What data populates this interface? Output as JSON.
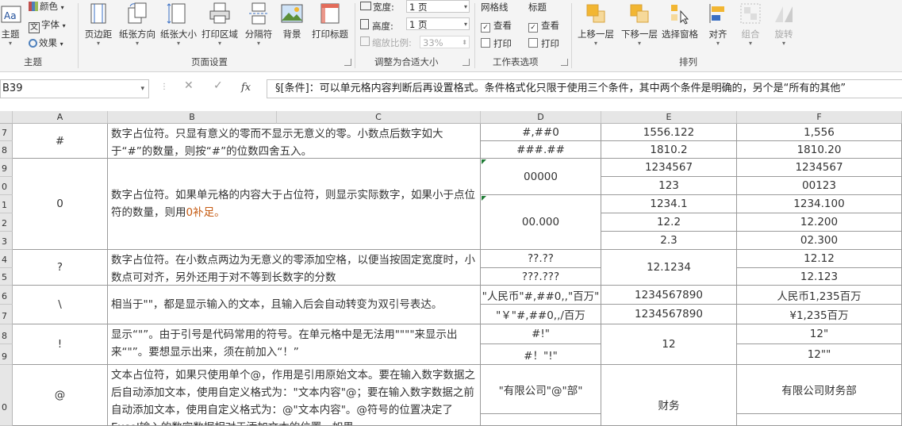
{
  "ribbon": {
    "theme_group": {
      "colors": "颜色",
      "fonts": "字体",
      "effects": "效果",
      "themes": "主题",
      "label": "主题"
    },
    "page_setup": {
      "margins": "页边距",
      "orientation": "纸张方向",
      "size": "纸张大小",
      "print_area": "打印区域",
      "breaks": "分隔符",
      "background": "背景",
      "print_titles": "打印标题",
      "label": "页面设置"
    },
    "scale_to_fit": {
      "width_label": "宽度:",
      "width_value": "1 页",
      "height_label": "高度:",
      "height_value": "1 页",
      "scale_label": "缩放比例:",
      "scale_value": "33%",
      "label": "调整为合适大小"
    },
    "sheet_options": {
      "gridlines": "网格线",
      "headings": "标题",
      "view": "查看",
      "print": "打印",
      "label": "工作表选项"
    },
    "arrange": {
      "bring_forward": "上移一层",
      "send_backward": "下移一层",
      "selection_pane": "选择窗格",
      "align": "对齐",
      "group": "组合",
      "rotate": "旋转",
      "label": "排列"
    }
  },
  "formula_bar": {
    "name_box": "B39",
    "fx": "fx",
    "content": "§[条件]：可以单元格内容判断后再设置格式。条件格式化只限于使用三个条件，其中两个条件是明确的，另个是“所有的其他”"
  },
  "columns": [
    "A",
    "B",
    "C",
    "D",
    "E",
    "F"
  ],
  "rows": [
    "7",
    "8",
    "9",
    "0",
    "1",
    "2",
    "3",
    "4",
    "5",
    "6",
    "7",
    "8",
    "9",
    "0"
  ],
  "cells": {
    "a_hash": "#",
    "a_zero": "0",
    "a_question": "?",
    "a_backslash": "\\",
    "a_bang": "!",
    "a_at": "@",
    "b_hash": "数字占位符。只显有意义的零而不显示无意义的零。小数点后数字如大于“#”的数量，则按“#”的位数四舍五入。",
    "b_zero_1": "数字占位符。如果单元格的内容大于占位符，则显示实际数字，如果小于点位符的数量，则用",
    "b_zero_2": "0补足。",
    "b_question": "数字占位符。在小数点两边为无意义的零添加空格，以便当按固定宽度时，小数点可对齐，另外还用于对不等到长数字的分数",
    "b_backslash": "相当于\"\"，都是显示输入的文本，且输入后会自动转变为双引号表达。",
    "b_bang": "显示“\"”。由于引号是代码常用的符号。在单元格中是无法用\"\"\"\"来显示出来“\"”。要想显示出来，须在前加入“！”",
    "b_at": "文本占位符，如果只使用单个@，作用是引用原始文本。要在输入数字数据之后自动添加文本，使用自定义格式为：\"文本内容\"@；要在输入数字数据之前自动添加文本，使用自定义格式为：@\"文本内容\"。@符号的位置决定了Excel输入的数字数据相对于添加文本的位置。如果",
    "d_r7": "#,##0",
    "d_r8": "###.##",
    "d_r9": "00000",
    "d_r11": "00.000",
    "d_r14": "??.??",
    "d_r15": "???.???",
    "d_r16": "\"人民币\"#,##0,,\"百万\"",
    "d_r17": "\"￥\"#,##0,,/百万",
    "d_r18": "#!\"",
    "d_r19": "#！\"!\"",
    "d_r20": "\"有限公司\"@\"部\"",
    "e_r7": "1556.122",
    "e_r8": "1810.2",
    "e_r9": "1234567",
    "e_r10": "123",
    "e_r11": "1234.1",
    "e_r12": "12.2",
    "e_r13": "2.3",
    "e_r14": "12.1234",
    "e_r16": "1234567890",
    "e_r17": "1234567890",
    "e_r18": "12",
    "e_r20": "财务",
    "f_r7": "1,556",
    "f_r8": "1810.20",
    "f_r9": "1234567",
    "f_r10": "00123",
    "f_r11": "1234.100",
    "f_r12": "12.200",
    "f_r13": "02.300",
    "f_r14": "12.12",
    "f_r15": "12.123",
    "f_r16": "人民币1,235百万",
    "f_r17": "¥1,235百万",
    "f_r18": "12\"",
    "f_r19": "12\"\"",
    "f_r20": "有限公司财务部"
  }
}
